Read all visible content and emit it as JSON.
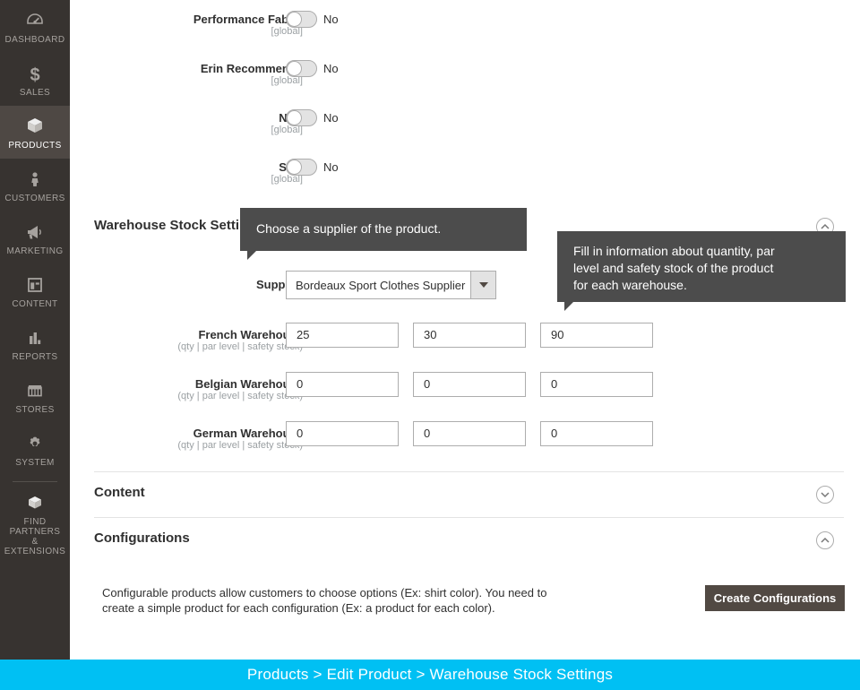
{
  "sidebar": {
    "items": [
      {
        "label": "DASHBOARD",
        "icon": "dashboard-gauge-icon",
        "active": false
      },
      {
        "label": "SALES",
        "icon": "dollar-sign-icon",
        "active": false
      },
      {
        "label": "PRODUCTS",
        "icon": "box-package-icon",
        "active": true
      },
      {
        "label": "CUSTOMERS",
        "icon": "person-icon",
        "active": false
      },
      {
        "label": "MARKETING",
        "icon": "megaphone-icon",
        "active": false
      },
      {
        "label": "CONTENT",
        "icon": "layout-page-icon",
        "active": false
      },
      {
        "label": "REPORTS",
        "icon": "bar-chart-icon",
        "active": false
      },
      {
        "label": "STORES",
        "icon": "storefront-icon",
        "active": false
      },
      {
        "label": "SYSTEM",
        "icon": "gear-icon",
        "active": false
      },
      {
        "label": "FIND PARTNERS\n& EXTENSIONS",
        "label_line1": "FIND PARTNERS",
        "label_line2": "& EXTENSIONS",
        "icon": "open-box-icon",
        "active": false
      }
    ]
  },
  "attributes": [
    {
      "label": "Performance Fabric",
      "scope": "[global]",
      "value": "No"
    },
    {
      "label": "Erin Recommends",
      "scope": "[global]",
      "value": "No"
    },
    {
      "label": "New",
      "scope": "[global]",
      "value": "No"
    },
    {
      "label": "Sale",
      "scope": "[global]",
      "value": "No"
    }
  ],
  "warehouse_section": {
    "title": "Warehouse Stock Settings",
    "supplier_label": "Supplier",
    "supplier_value": "Bordeaux Sport Clothes Supplier",
    "rows": [
      {
        "label": "French Warehouse",
        "sub": "(qty | par level | safety stock)",
        "qty": "25",
        "par": "30",
        "safety": "90"
      },
      {
        "label": "Belgian Warehouse",
        "sub": "(qty | par level | safety stock)",
        "qty": "0",
        "par": "0",
        "safety": "0"
      },
      {
        "label": "German Warehouse",
        "sub": "(qty | par level | safety stock)",
        "qty": "0",
        "par": "0",
        "safety": "0"
      }
    ]
  },
  "content_section": {
    "title": "Content",
    "collapse_icon": "chevron-down-icon"
  },
  "configurations_section": {
    "title": "Configurations",
    "collapse_icon": "chevron-up-icon",
    "description_line1": "Configurable products allow customers to choose options (Ex: shirt color). You need to",
    "description_line2": "create a simple product for each configuration (Ex: a product for each color).",
    "button_label": "Create Configurations"
  },
  "tooltips": [
    {
      "id": "supplier-tooltip",
      "text": "Choose a supplier of the product."
    },
    {
      "id": "warehouse-tooltip",
      "line1": "Fill in information about quantity, par",
      "line2": "level and safety stock of the product",
      "line3": "for each warehouse.",
      "text": "Fill in information about quantity, par level and safety stock of the product for each warehouse."
    }
  ],
  "breadcrumb": {
    "text": "Products > Edit Product > Warehouse Stock Settings"
  },
  "colors": {
    "sidebar_bg": "#373330",
    "sidebar_active_bg": "#4e4844",
    "accent_bottom_bar": "#00c0f3",
    "button_primary": "#514943",
    "tooltip_bg": "#4c4c4c"
  }
}
